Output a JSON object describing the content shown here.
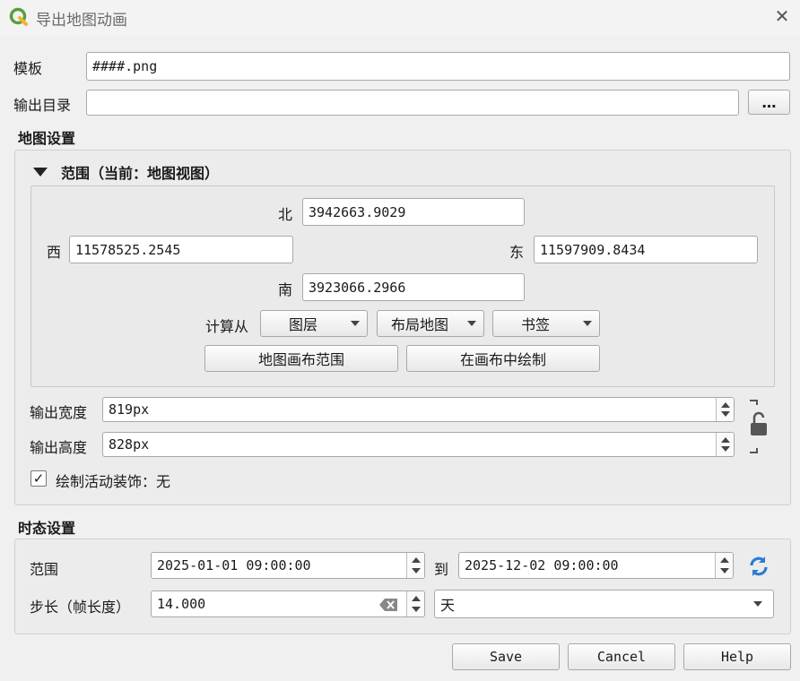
{
  "window": {
    "title": "导出地图动画",
    "close_glyph": "✕",
    "app_icon": "qgis-logo-icon"
  },
  "template": {
    "label": "模板",
    "value": "####.png"
  },
  "output_dir": {
    "label": "输出目录",
    "value": "",
    "browse_label": "…"
  },
  "map_settings": {
    "title": "地图设置",
    "extent": {
      "title": "范围（当前：地图视图）",
      "north_label": "北",
      "north_value": "3942663.9029",
      "west_label": "西",
      "west_value": "11578525.2545",
      "east_label": "东",
      "east_value": "11597909.8434",
      "south_label": "南",
      "south_value": "3923066.2966",
      "calc_from_label": "计算从",
      "layer_combo": "图层",
      "layout_map_combo": "布局地图",
      "bookmark_combo": "书签",
      "map_canvas_extent_button": "地图画布范围",
      "draw_on_canvas_button": "在画布中绘制"
    },
    "output_width": {
      "label": "输出宽度",
      "value": "819px"
    },
    "output_height": {
      "label": "输出高度",
      "value": "828px"
    },
    "draw_decorations": {
      "label": "绘制活动装饰：无",
      "checked": true,
      "check_glyph": "✓"
    }
  },
  "temporal_settings": {
    "title": "时态设置",
    "range_label": "范围",
    "range_start": "2025-01-01 09:00:00",
    "to_label": "到",
    "range_end": "2025-12-02 09:00:00",
    "step_label": "步长（帧长度）",
    "step_value": "14.000",
    "step_unit": "天"
  },
  "buttons": {
    "save": "Save",
    "cancel": "Cancel",
    "help": "Help"
  }
}
